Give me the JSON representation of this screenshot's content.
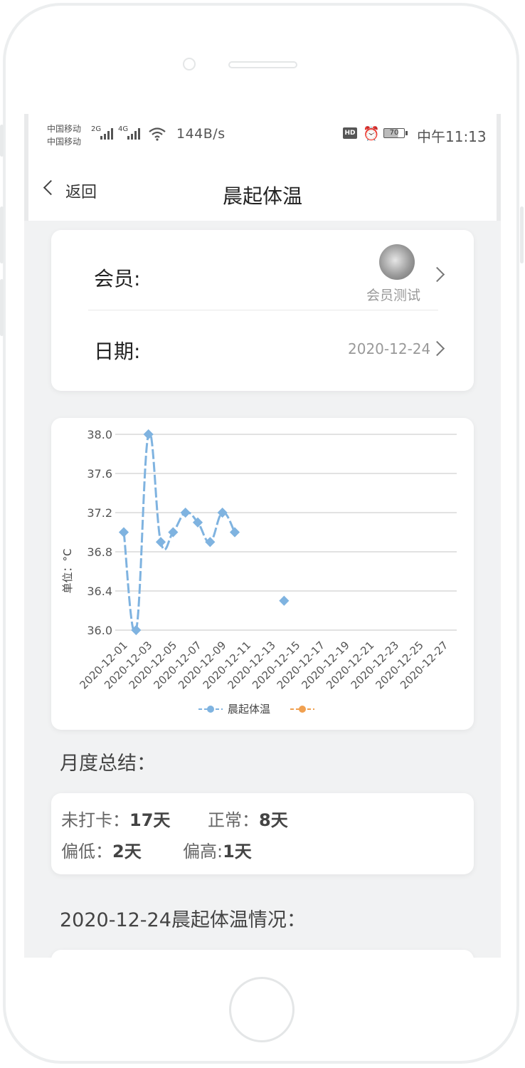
{
  "status_bar": {
    "carrier_1": "中国移动",
    "carrier_2": "中国移动",
    "net_2g": "2G",
    "net_4g": "4G",
    "net_speed": "144B/s",
    "hd": "HD",
    "battery": "70",
    "time": "中午11:13"
  },
  "nav": {
    "back_label": "返回",
    "title": "晨起体温"
  },
  "member": {
    "label": "会员:",
    "name": "会员测试"
  },
  "date": {
    "label": "日期:",
    "value": "2020-12-24"
  },
  "chart_data": {
    "type": "line",
    "ylabel": "单位：°C",
    "ylim": [
      36.0,
      38.0
    ],
    "yticks": [
      "38.0",
      "37.6",
      "37.2",
      "36.8",
      "36.4",
      "36.0"
    ],
    "x": [
      "2020-12-01",
      "2020-12-02",
      "2020-12-03",
      "2020-12-04",
      "2020-12-05",
      "2020-12-06",
      "2020-12-07",
      "2020-12-08",
      "2020-12-09",
      "2020-12-10",
      "2020-12-11",
      "2020-12-12",
      "2020-12-13",
      "2020-12-14",
      "2020-12-15",
      "2020-12-16",
      "2020-12-17",
      "2020-12-18",
      "2020-12-19",
      "2020-12-20",
      "2020-12-21",
      "2020-12-22",
      "2020-12-23",
      "2020-12-24",
      "2020-12-25",
      "2020-12-26",
      "2020-12-27",
      "2020-12-28"
    ],
    "xticks": [
      "2020-12-01",
      "2020-12-03",
      "2020-12-05",
      "2020-12-07",
      "2020-12-09",
      "2020-12-11",
      "2020-12-13",
      "2020-12-15",
      "2020-12-17",
      "2020-12-19",
      "2020-12-21",
      "2020-12-23",
      "2020-12-25",
      "2020-12-27"
    ],
    "series": [
      {
        "name": "晨起体温",
        "color": "#7fb3e0",
        "values": [
          37.0,
          36.0,
          38.0,
          36.9,
          37.0,
          37.2,
          37.1,
          36.9,
          37.2,
          37.0,
          null,
          null,
          null,
          36.3,
          null,
          null,
          null,
          null,
          null,
          null,
          null,
          null,
          null,
          null,
          null,
          null,
          null,
          null
        ]
      },
      {
        "name": "",
        "color": "#f0a050",
        "values": []
      }
    ],
    "legend_position": "bottom",
    "grid": true
  },
  "monthly": {
    "title": "月度总结：",
    "missed_label": "未打卡：",
    "missed_value": "17天",
    "normal_label": "正常：",
    "normal_value": "8天",
    "low_label": "偏低：",
    "low_value": "2天",
    "high_label": "偏高:",
    "high_value": "1天"
  },
  "daily_title": "2020-12-24晨起体温情况："
}
